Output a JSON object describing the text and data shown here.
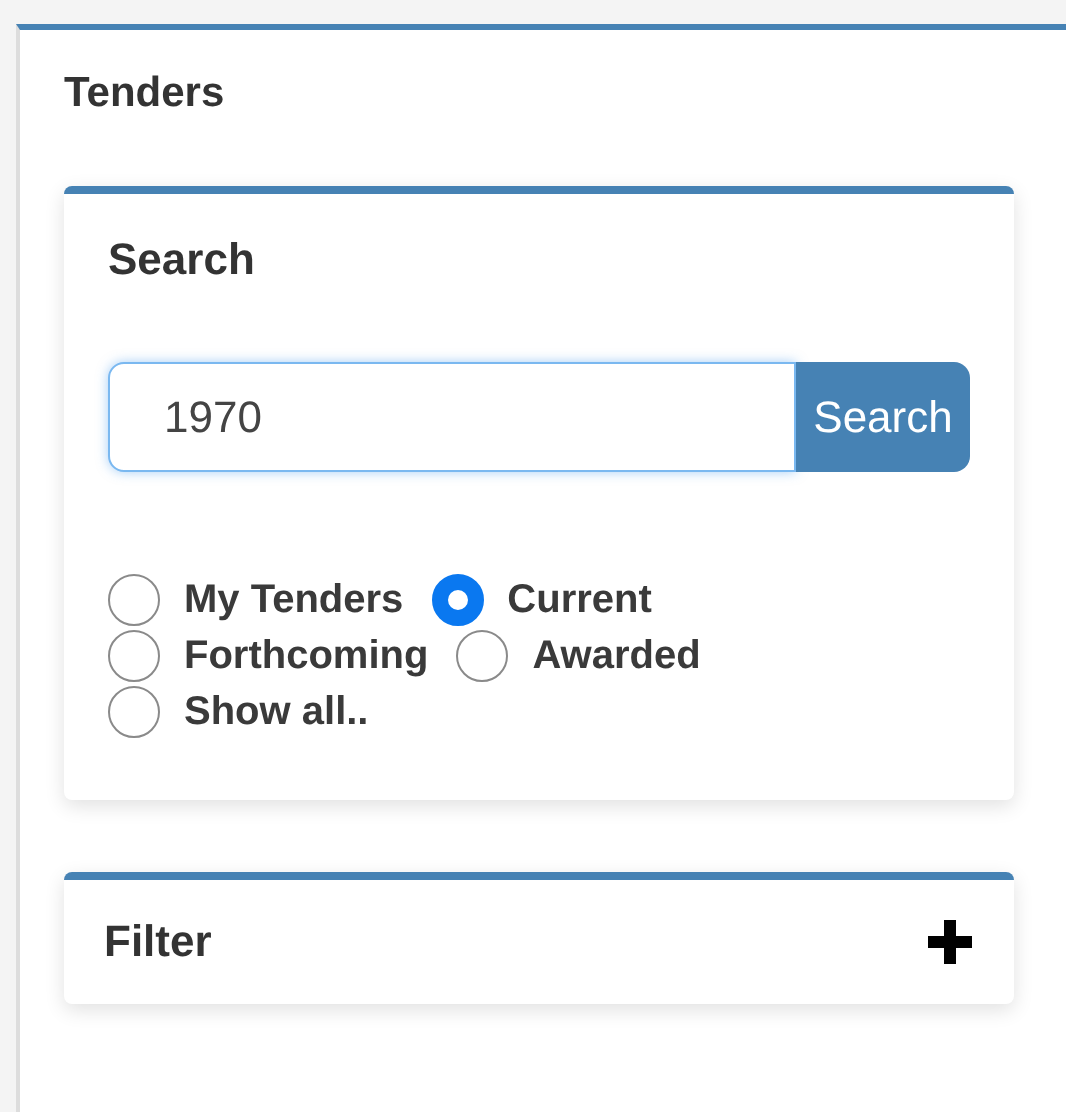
{
  "panel": {
    "title": "Tenders"
  },
  "search": {
    "title": "Search",
    "query": "1970",
    "button": "Search",
    "options": [
      {
        "label": "My Tenders",
        "selected": false
      },
      {
        "label": "Current",
        "selected": true
      },
      {
        "label": "Forthcoming",
        "selected": false
      },
      {
        "label": "Awarded",
        "selected": false
      },
      {
        "label": "Show all..",
        "selected": false
      }
    ]
  },
  "filter": {
    "title": "Filter",
    "expanded": false
  }
}
